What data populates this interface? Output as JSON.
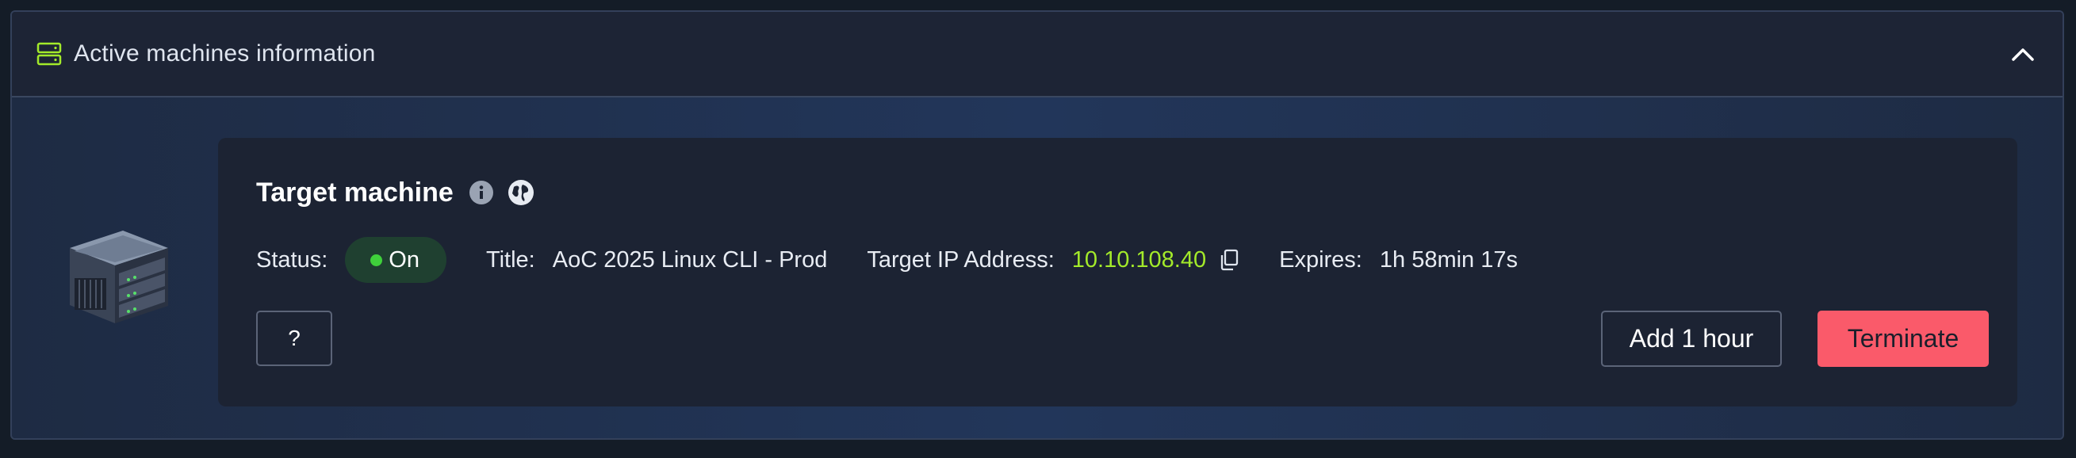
{
  "panel": {
    "title": "Active machines information",
    "header_icon": "server-stack-icon",
    "collapse_icon": "chevron-up-icon"
  },
  "machine": {
    "image": "server-machine-image",
    "title": "Target machine",
    "info_icon": "info-icon",
    "globe_icon": "globe-icon",
    "status_label": "Status:",
    "status_value": "On",
    "title_label": "Title:",
    "title_value": "AoC 2025 Linux CLI - Prod",
    "ip_label": "Target IP Address:",
    "ip_value": "10.10.108.40",
    "copy_icon": "copy-icon",
    "expires_label": "Expires:",
    "expires_value": "1h 58min 17s"
  },
  "actions": {
    "help_label": "?",
    "add_hour_label": "Add 1 hour",
    "terminate_label": "Terminate"
  },
  "colors": {
    "accent_green": "#a3ea2a",
    "status_dot": "#3fd13b",
    "terminate": "#fa5a6a"
  }
}
